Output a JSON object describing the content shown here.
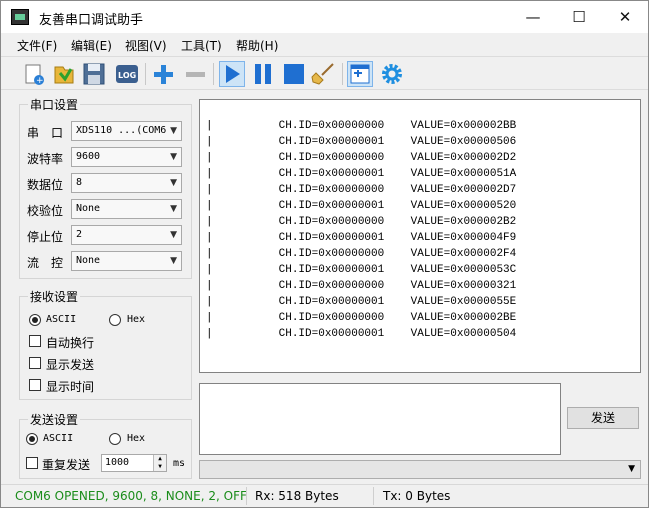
{
  "window": {
    "title": "友善串口调试助手",
    "minimize": "—",
    "maximize": "☐",
    "close": "✕"
  },
  "menu": [
    "文件(F)",
    "编辑(E)",
    "视图(V)",
    "工具(T)",
    "帮助(H)"
  ],
  "toolbar": {
    "log_label": "LOG"
  },
  "serial": {
    "title": "串口设置",
    "rows": [
      {
        "label": "串　口",
        "value": "XDS110 ...(COM6"
      },
      {
        "label": "波特率",
        "value": "9600"
      },
      {
        "label": "数据位",
        "value": "8"
      },
      {
        "label": "校验位",
        "value": "None"
      },
      {
        "label": "停止位",
        "value": "2"
      },
      {
        "label": "流　控",
        "value": "None"
      }
    ]
  },
  "receive": {
    "title": "接收设置",
    "ascii": "ASCII",
    "hex": "Hex",
    "auto_wrap": "自动换行",
    "show_send": "显示发送",
    "show_time": "显示时间"
  },
  "send": {
    "title": "发送设置",
    "ascii": "ASCII",
    "hex": "Hex",
    "repeat": "重复发送",
    "interval": "1000",
    "unit": "ms",
    "button": "发送"
  },
  "recv_lines": [
    "|          CH.ID=0x00000000    VALUE=0x000002BB",
    "|          CH.ID=0x00000001    VALUE=0x00000506",
    "|          CH.ID=0x00000000    VALUE=0x000002D2",
    "|          CH.ID=0x00000001    VALUE=0x0000051A",
    "|          CH.ID=0x00000000    VALUE=0x000002D7",
    "|          CH.ID=0x00000001    VALUE=0x00000520",
    "|          CH.ID=0x00000000    VALUE=0x000002B2",
    "|          CH.ID=0x00000001    VALUE=0x000004F9",
    "|          CH.ID=0x00000000    VALUE=0x000002F4",
    "|          CH.ID=0x00000001    VALUE=0x0000053C",
    "|          CH.ID=0x00000000    VALUE=0x00000321",
    "|          CH.ID=0x00000001    VALUE=0x0000055E",
    "|          CH.ID=0x00000000    VALUE=0x000002BE",
    "|          CH.ID=0x00000001    VALUE=0x00000504"
  ],
  "status": {
    "port": "COM6 OPENED, 9600, 8, NONE, 2, OFF",
    "rx": "Rx: 518 Bytes",
    "tx": "Tx: 0 Bytes",
    "port_color": "#1a8c1a"
  }
}
